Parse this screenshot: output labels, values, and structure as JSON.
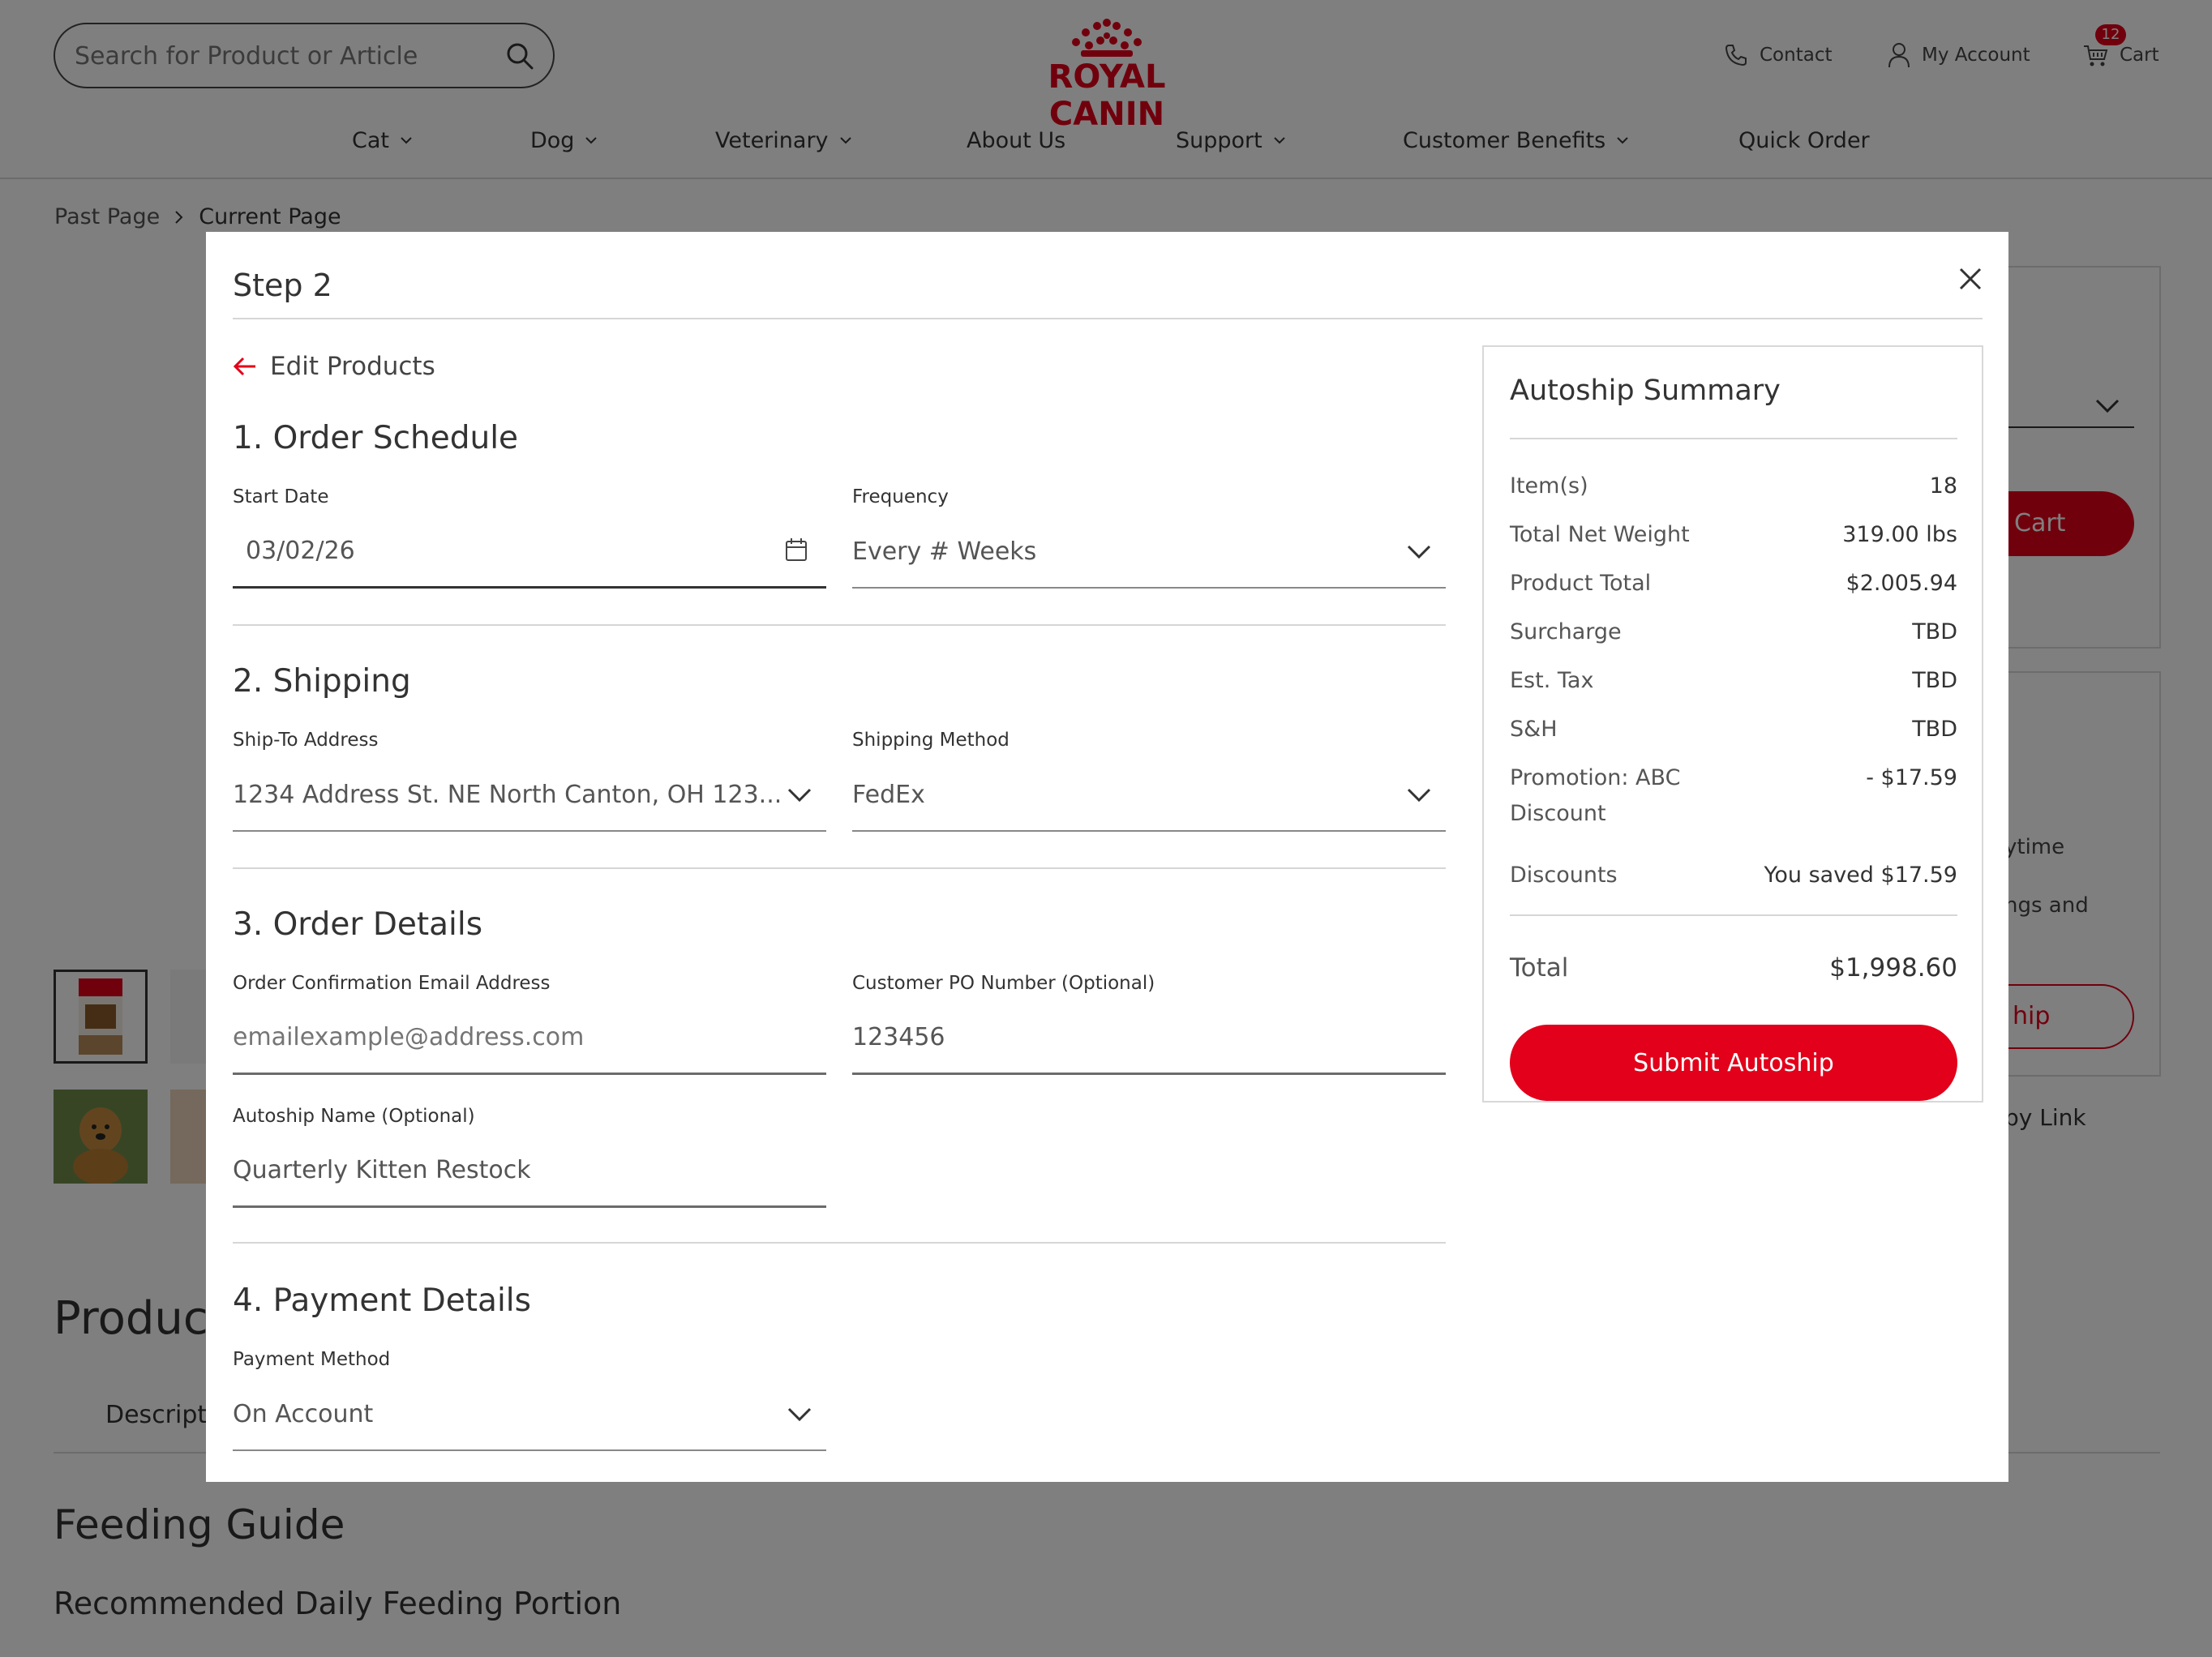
{
  "header": {
    "search_placeholder": "Search for Product or Article",
    "logo_text": "ROYAL CANIN",
    "contact_label": "Contact",
    "account_label": "My Account",
    "cart_label": "Cart",
    "cart_count": "12"
  },
  "nav": {
    "items": [
      {
        "label": "Cat"
      },
      {
        "label": "Dog"
      },
      {
        "label": "Veterinary"
      },
      {
        "label": "About Us"
      },
      {
        "label": "Support"
      },
      {
        "label": "Customer Benefits"
      },
      {
        "label": "Quick Order"
      }
    ]
  },
  "breadcrumb": {
    "past": "Past Page",
    "current": "Current Page"
  },
  "background": {
    "cart_button_fragment": "Cart",
    "text_fragment_1": "ytime",
    "text_fragment_2": "ngs and",
    "outline_button_fragment": "hip",
    "copy_link_fragment": "py Link",
    "heading_product_fragment": "Produc",
    "tab_description_fragment": "Descript",
    "feeding_guide": "Feeding Guide",
    "recommended_portion": "Recommended Daily Feeding Portion"
  },
  "modal": {
    "title": "Step 2",
    "back_label": "Edit Products",
    "sections": {
      "schedule": {
        "title": "1. Order Schedule",
        "start_date_label": "Start Date",
        "start_date_value": "03/02/26",
        "frequency_label": "Frequency",
        "frequency_value": "Every # Weeks"
      },
      "shipping": {
        "title": "2. Shipping",
        "address_label": "Ship-To Address",
        "address_value": "1234 Address St. NE North Canton, OH 123...",
        "method_label": "Shipping Method",
        "method_value": "FedEx"
      },
      "order_details": {
        "title": "3. Order Details",
        "email_label": "Order Confirmation Email Address",
        "email_placeholder": "emailexample@address.com",
        "po_label": "Customer PO Number (Optional)",
        "po_value": "123456",
        "name_label": "Autoship Name (Optional)",
        "name_value": "Quarterly Kitten Restock"
      },
      "payment": {
        "title": "4. Payment Details",
        "method_label": "Payment Method",
        "method_value": "On Account"
      }
    },
    "summary": {
      "title": "Autoship Summary",
      "rows": [
        {
          "label": "Item(s)",
          "value": "18"
        },
        {
          "label": "Total Net Weight",
          "value": "319.00 lbs"
        },
        {
          "label": "Product Total",
          "value": "$2.005.94"
        },
        {
          "label": "Surcharge",
          "value": "TBD"
        },
        {
          "label": "Est. Tax",
          "value": "TBD"
        },
        {
          "label": "S&H",
          "value": "TBD"
        },
        {
          "label": "Promotion: ABC Discount",
          "value": "- $17.59"
        },
        {
          "label": "Discounts",
          "value": "You saved $17.59"
        }
      ],
      "total_label": "Total",
      "total_value": "$1,998.60",
      "submit_label": "Submit Autoship"
    }
  },
  "colors": {
    "brand_red": "#e2001a",
    "overlay": "rgba(0,0,0,0.5)"
  }
}
